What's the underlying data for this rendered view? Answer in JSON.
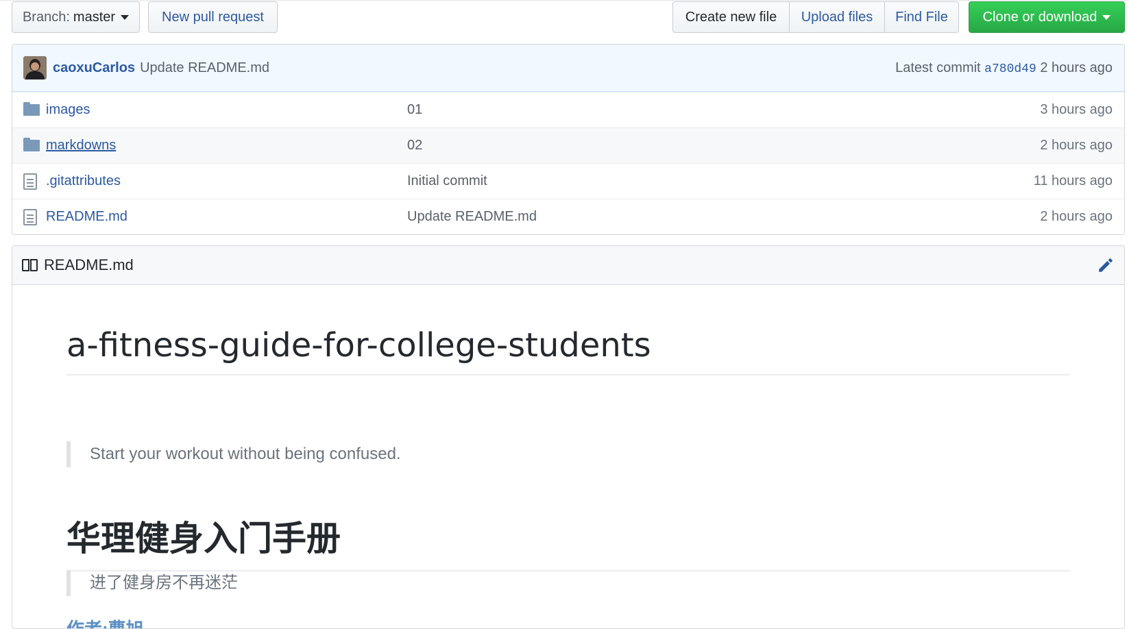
{
  "toolbar": {
    "branch_label": "Branch:",
    "branch_value": "master",
    "new_pr": "New pull request",
    "create_file": "Create new file",
    "upload_files": "Upload files",
    "find_file": "Find File",
    "clone_download": "Clone or download"
  },
  "commit": {
    "author": "caoxuCarlos",
    "message": "Update README.md",
    "latest_label": "Latest commit",
    "sha": "a780d49",
    "time": "2 hours ago"
  },
  "files": [
    {
      "type": "dir",
      "name": "images",
      "message": "01",
      "age": "3 hours ago"
    },
    {
      "type": "dir",
      "name": "markdowns",
      "message": "02",
      "age": "2 hours ago"
    },
    {
      "type": "file",
      "name": ".gitattributes",
      "message": "Initial commit",
      "age": "11 hours ago"
    },
    {
      "type": "file",
      "name": "README.md",
      "message": "Update README.md",
      "age": "2 hours ago"
    }
  ],
  "readme": {
    "filename": "README.md",
    "title_en": "a-fitness-guide-for-college-students",
    "quote_en": "Start your workout without being confused.",
    "title_zh": "华理健身入门手册",
    "quote_zh": "进了健身房不再迷茫",
    "author": "作者:曹旭"
  },
  "colors": {
    "link": "#2c5aa0",
    "clone_green": "#28a745",
    "commit_bg": "#f1f8ff"
  }
}
